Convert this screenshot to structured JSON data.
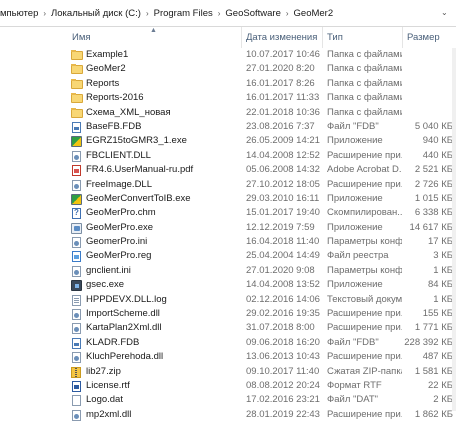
{
  "breadcrumb": [
    "мпьютер",
    "Локальный диск (C:)",
    "Program Files",
    "GeoSoftware",
    "GeoMer2"
  ],
  "columns": {
    "name": "Имя",
    "date": "Дата изменения",
    "type": "Тип",
    "size": "Размер"
  },
  "files": [
    {
      "icon": "folder-icon",
      "name": "Example1",
      "date": "10.07.2017 10:46",
      "type": "Папка с файлами",
      "size": ""
    },
    {
      "icon": "folder-icon",
      "name": "GeoMer2",
      "date": "27.01.2020 8:20",
      "type": "Папка с файлами",
      "size": ""
    },
    {
      "icon": "folder-icon",
      "name": "Reports",
      "date": "16.01.2017 8:26",
      "type": "Папка с файлами",
      "size": ""
    },
    {
      "icon": "folder-icon",
      "name": "Reports-2016",
      "date": "16.01.2017 11:33",
      "type": "Папка с файлами",
      "size": ""
    },
    {
      "icon": "folder-icon",
      "name": "Схема_XML_новая",
      "date": "22.01.2018 10:36",
      "type": "Папка с файлами",
      "size": ""
    },
    {
      "icon": "fdb-file-icon",
      "name": "BaseFB.FDB",
      "date": "23.08.2016 7:37",
      "type": "Файл \"FDB\"",
      "size": "5 040 КБ"
    },
    {
      "icon": "exe-icon",
      "name": "EGRZ15toGMR3_1.exe",
      "date": "26.05.2009 14:21",
      "type": "Приложение",
      "size": "940 КБ"
    },
    {
      "icon": "dll-file-icon",
      "name": "FBCLIENT.DLL",
      "date": "14.04.2008 12:52",
      "type": "Расширение при...",
      "size": "440 КБ"
    },
    {
      "icon": "pdf-file-icon",
      "name": "FR4.6.UserManual-ru.pdf",
      "date": "05.06.2008 14:32",
      "type": "Adobe Acrobat D...",
      "size": "2 521 КБ"
    },
    {
      "icon": "dll-file-icon",
      "name": "FreeImage.DLL",
      "date": "27.10.2012 18:05",
      "type": "Расширение при...",
      "size": "2 726 КБ"
    },
    {
      "icon": "exe-icon",
      "name": "GeoMerConvertToIB.exe",
      "date": "29.03.2010 16:11",
      "type": "Приложение",
      "size": "1 015 КБ"
    },
    {
      "icon": "help-file-icon",
      "name": "GeoMerPro.chm",
      "date": "15.01.2017 19:40",
      "type": "Скомпилирован...",
      "size": "6 338 КБ"
    },
    {
      "icon": "app-exe-icon",
      "name": "GeoMerPro.exe",
      "date": "12.12.2019 7:59",
      "type": "Приложение",
      "size": "14 617 КБ"
    },
    {
      "icon": "ini-file-icon",
      "name": "GeomerPro.ini",
      "date": "16.04.2018 11:40",
      "type": "Параметры конф...",
      "size": "17 КБ"
    },
    {
      "icon": "reg-file-icon",
      "name": "GeoMerPro.reg",
      "date": "25.04.2004 14:49",
      "type": "Файл реестра",
      "size": "3 КБ"
    },
    {
      "icon": "ini-file-icon",
      "name": "gnclient.ini",
      "date": "27.01.2020 9:08",
      "type": "Параметры конф...",
      "size": "1 КБ"
    },
    {
      "icon": "dark-exe-icon",
      "name": "gsec.exe",
      "date": "14.04.2008 13:52",
      "type": "Приложение",
      "size": "84 КБ"
    },
    {
      "icon": "log-file-icon",
      "name": "HPPDEVX.DLL.log",
      "date": "02.12.2016 14:06",
      "type": "Текстовый докум...",
      "size": "1 КБ"
    },
    {
      "icon": "dll-file-icon",
      "name": "ImportScheme.dll",
      "date": "29.02.2016 19:35",
      "type": "Расширение при...",
      "size": "155 КБ"
    },
    {
      "icon": "dll-file-icon",
      "name": "KartaPlan2Xml.dll",
      "date": "31.07.2018 8:00",
      "type": "Расширение при...",
      "size": "1 771 КБ"
    },
    {
      "icon": "fdb-file-icon",
      "name": "KLADR.FDB",
      "date": "09.06.2018 16:20",
      "type": "Файл \"FDB\"",
      "size": "228 392 КБ"
    },
    {
      "icon": "dll-file-icon",
      "name": "KluchPerehoda.dll",
      "date": "13.06.2013 10:43",
      "type": "Расширение при...",
      "size": "487 КБ"
    },
    {
      "icon": "zip-icon",
      "name": "lib27.zip",
      "date": "09.10.2017 11:40",
      "type": "Сжатая ZIP-папка",
      "size": "1 581 КБ"
    },
    {
      "icon": "rtf-file-icon",
      "name": "License.rtf",
      "date": "08.08.2012 20:24",
      "type": "Формат RTF",
      "size": "22 КБ"
    },
    {
      "icon": "dat-file-icon",
      "name": "Logo.dat",
      "date": "17.02.2016 23:21",
      "type": "Файл \"DAT\"",
      "size": "2 КБ"
    },
    {
      "icon": "dll-file-icon",
      "name": "mp2xml.dll",
      "date": "28.01.2019 22:43",
      "type": "Расширение при...",
      "size": "1 862 КБ"
    }
  ]
}
